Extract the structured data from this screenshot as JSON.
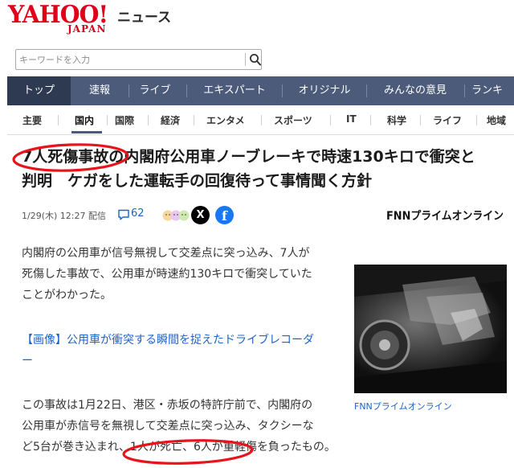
{
  "header": {
    "logo_text": "YAHOO!",
    "logo_sub": "JAPAN",
    "service_name": "ニュース"
  },
  "search": {
    "placeholder": "キーワードを入力",
    "icon": "search-icon"
  },
  "main_nav": {
    "items": [
      {
        "label": "トップ",
        "active": true
      },
      {
        "label": "速報",
        "active": false
      },
      {
        "label": "ライブ",
        "active": false
      },
      {
        "label": "エキスパート",
        "active": false
      },
      {
        "label": "オリジナル",
        "active": false
      },
      {
        "label": "みんなの意見",
        "active": false
      },
      {
        "label": "ランキ",
        "active": false
      }
    ]
  },
  "sub_nav": {
    "items": [
      {
        "label": "主要",
        "active": false
      },
      {
        "label": "国内",
        "active": true
      },
      {
        "label": "国際",
        "active": false
      },
      {
        "label": "経済",
        "active": false
      },
      {
        "label": "エンタメ",
        "active": false
      },
      {
        "label": "スポーツ",
        "active": false
      },
      {
        "label": "IT",
        "active": false
      },
      {
        "label": "科学",
        "active": false
      },
      {
        "label": "ライフ",
        "active": false
      },
      {
        "label": "地域",
        "active": false
      }
    ]
  },
  "article": {
    "title_line1": "7人死傷事故の内閣府公用車ノーブレーキで時速130キロで衝突と",
    "title_line2": "判明　ケガをした運転手の回復待って事情聞く方針",
    "date": "1/29(木) 12:27 配信",
    "comment_count": "62",
    "share_x": "X",
    "share_facebook": "f",
    "source": "FNNプライムオンライン",
    "para1": [
      "内閣府の公用車が信号無視して交差点に突っ込み、7人が",
      "死傷した事故で、公用車が時速約130キロで衝突していた",
      "ことがわかった。"
    ],
    "image_link": [
      "【画像】公用車が衝突する瞬間を捉えたドライブレコーダ",
      "ー"
    ],
    "para2": [
      "この事故は1月22日、港区・赤坂の特許庁前で、内閣府の",
      "公用車が赤信号を無視して交差点に突っ込み、タクシーな",
      "ど5台が巻き込まれ、1人が死亡、6人が重軽傷を負ったもの。"
    ],
    "photo_caption": "FNNプライムオンライン"
  },
  "colors": {
    "logo_red": "#e0001a",
    "nav_bg": "#4c5b7a",
    "nav_active": "#2d3a52",
    "link_blue": "#1d64c8",
    "annotation_red": "#e8141c"
  }
}
